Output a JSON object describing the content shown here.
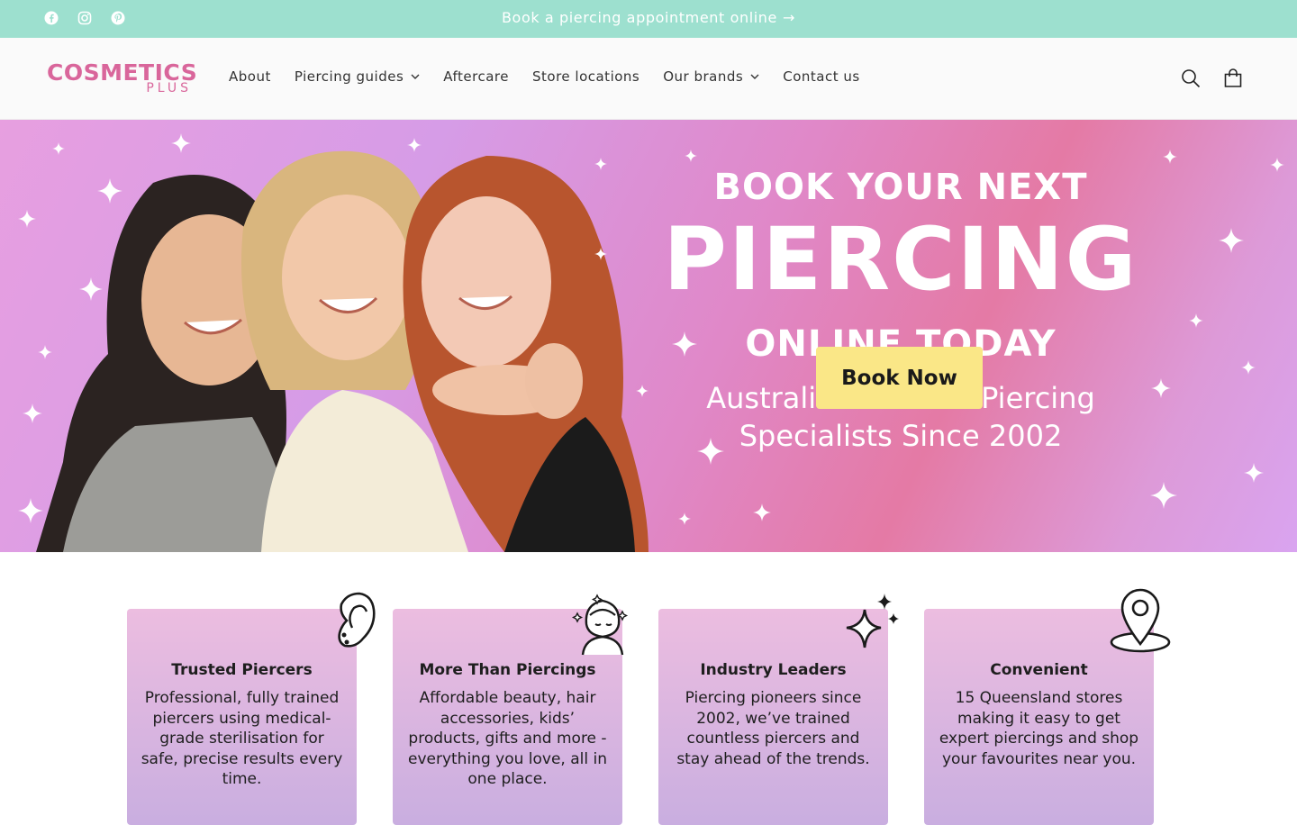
{
  "announcement": {
    "text": "Book a piercing appointment online",
    "arrow": "→",
    "bg_color": "#9de0cf",
    "social_icons": [
      "facebook-icon",
      "instagram-icon",
      "pinterest-icon"
    ]
  },
  "header": {
    "logo": {
      "line1": "COSMETICS",
      "line2": "PLUS",
      "color": "#d9669b"
    },
    "nav": [
      {
        "label": "About",
        "dropdown": false
      },
      {
        "label": "Piercing guides",
        "dropdown": true
      },
      {
        "label": "Aftercare",
        "dropdown": false
      },
      {
        "label": "Store locations",
        "dropdown": false
      },
      {
        "label": "Our brands",
        "dropdown": true
      },
      {
        "label": "Contact us",
        "dropdown": false
      }
    ],
    "icons": [
      "search-icon",
      "cart-icon"
    ]
  },
  "hero": {
    "line1": "BOOK YOUR NEXT",
    "line2": "PIERCING",
    "line3": "ONLINE TODAY",
    "line4": "Australia's Trusted Piercing Specialists Since 2002",
    "button_label": "Book Now",
    "button_color": "#fae787"
  },
  "features": [
    {
      "title": "Trusted Piercers",
      "text": "Professional, fully trained piercers using medical-grade sterilisation for safe, precise results every time.",
      "icon": "ear-icon"
    },
    {
      "title": "More Than Piercings",
      "text": "Affordable beauty, hair accessories, kids’ products, gifts and more - everything you love, all in one place.",
      "icon": "woman-beauty-icon"
    },
    {
      "title": "Industry Leaders",
      "text": "Piercing pioneers since 2002, we’ve trained countless piercers and stay ahead of the trends.",
      "icon": "sparkle-icon"
    },
    {
      "title": "Convenient",
      "text": "15 Queensland stores making it easy to get expert piercings and shop your favourites near you.",
      "icon": "location-pin-icon"
    }
  ]
}
